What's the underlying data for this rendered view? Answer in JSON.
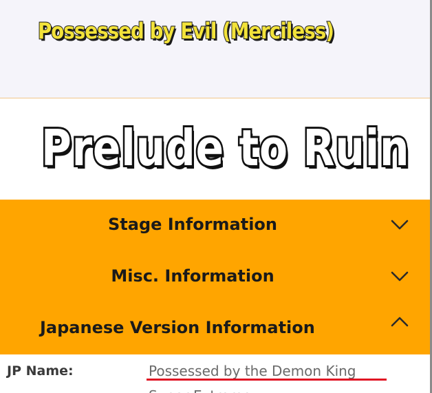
{
  "header": {
    "subtitle": "Possessed by Evil (Merciless)"
  },
  "stage": {
    "title": "Prelude to Ruin"
  },
  "accordion": {
    "items": [
      {
        "label": "Stage Information",
        "state": "collapsed",
        "icon": "chevron-down-icon"
      },
      {
        "label": "Misc. Information",
        "state": "collapsed",
        "icon": "chevron-down-icon"
      },
      {
        "label": "Japanese Version Information",
        "state": "expanded",
        "icon": "chevron-up-icon"
      }
    ]
  },
  "jp_info": {
    "name_key": "JP Name:",
    "name_value": "Possessed by the Demon King",
    "name_value_cont": "Super Extreme"
  },
  "colors": {
    "accent": "#ffa500",
    "annotation": "#e01022"
  }
}
